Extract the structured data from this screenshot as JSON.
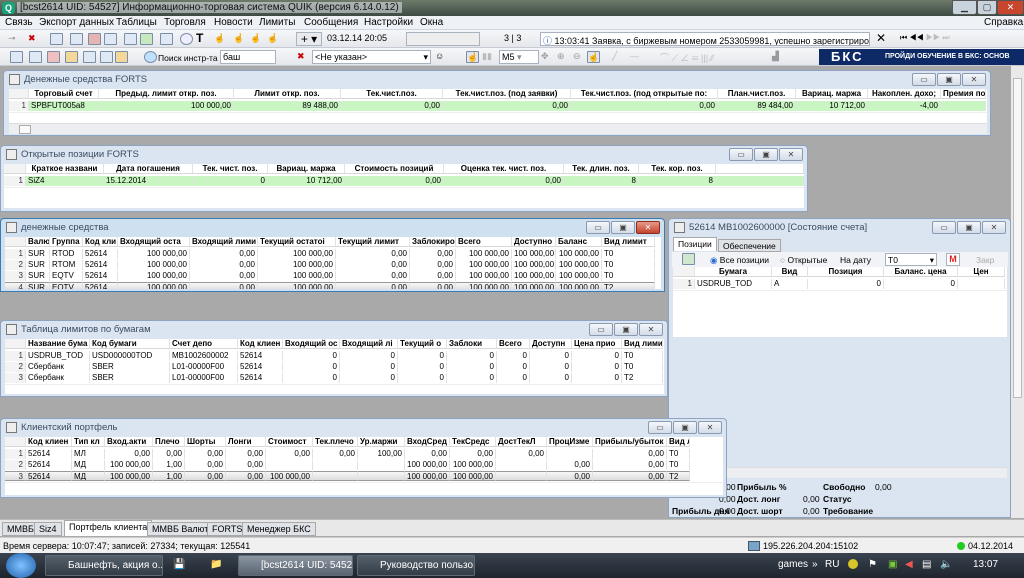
{
  "app": {
    "title": "[bcst2614 UID: 54527] Информационно-торговая система QUIK (версия 6.14.0.12)",
    "logo": "Q"
  },
  "menu": [
    "Связь",
    "Экспорт данных",
    "Таблицы",
    "Торговля",
    "Новости",
    "Лимиты",
    "Сообщения",
    "Настройки",
    "Окна"
  ],
  "menu_help": "Справка",
  "toolbar": {
    "datetime": "03.12.14 20:05",
    "counter": "3 | 3",
    "message": "13:03:41  Заявка, с биржевым номером 2533059981, успешно зарегистрирова",
    "search_label": "Поиск инстр-та",
    "search_value": "баш",
    "client_select": "<Не указан>",
    "interval": "M5",
    "banner_logo": "БКС",
    "banner_text": "ПРОЙДИ ОБУЧЕНИЕ В БКС: ОСНОВ"
  },
  "windows": {
    "forts_money": {
      "title": "Денежные средства FORTS",
      "headers": [
        "",
        "Торговый счет",
        "Предыд. лимит откр. поз.",
        "Лимит откр. поз.",
        "Тек.чист.поз.",
        "Тек.чист.поз. (под заявки)",
        "Тек.чист.поз. (под открытые по:",
        "План.чист.поз.",
        "Вариац. маржа",
        "Накоплен. дохо;",
        "Премия по"
      ],
      "rows": [
        [
          "1",
          "SPBFUT005a8",
          "100 000,00",
          "89 488,00",
          "0,00",
          "0,00",
          "0,00",
          "89 484,00",
          "10 712,00",
          "-4,00",
          ""
        ]
      ]
    },
    "forts_positions": {
      "title": "Открытые позиции FORTS",
      "headers": [
        "",
        "Краткое названи",
        "Дата погашения",
        "Тек. чист. поз.",
        "Вариац. маржа",
        "Стоимость позиций",
        "Оценка тек. чист. поз.",
        "Тек. длин. поз.",
        "Тек. кор. поз.",
        ""
      ],
      "rows": [
        [
          "1",
          "SiZ4",
          "15.12.2014",
          "0",
          "10 712,00",
          "0,00",
          "0,00",
          "8",
          "8",
          ""
        ]
      ]
    },
    "money": {
      "title": "денежные средства",
      "headers": [
        "",
        "Валю",
        "Группа",
        "Код кли",
        "Входящий оста",
        "Входящий лими",
        "Текущий остатоі",
        "Текущий лимит",
        "Заблокиро",
        "Всего",
        "Доступно",
        "Баланс",
        "Вид лимит"
      ],
      "rows": [
        [
          "1",
          "SUR",
          "RTOD",
          "52614",
          "100 000,00",
          "0,00",
          "100 000,00",
          "0,00",
          "0,00",
          "100 000,00",
          "100 000,00",
          "100 000,00",
          "T0"
        ],
        [
          "2",
          "SUR",
          "RTOM",
          "52614",
          "100 000,00",
          "0,00",
          "100 000,00",
          "0,00",
          "0,00",
          "100 000,00",
          "100 000,00",
          "100 000,00",
          "T0"
        ],
        [
          "3",
          "SUR",
          "EQTV",
          "52614",
          "100 000,00",
          "0,00",
          "100 000,00",
          "0,00",
          "0,00",
          "100 000,00",
          "100 000,00",
          "100 000,00",
          "T0"
        ],
        [
          "4",
          "SUR",
          "EQTV",
          "52614",
          "100 000,00",
          "0,00",
          "100 000,00",
          "0,00",
          "0,00",
          "100 000,00",
          "100 000,00",
          "100 000,00",
          "T2"
        ]
      ]
    },
    "account_state": {
      "title": "52614 MB1002600000 [Состояние счета]",
      "tabs": [
        "Позиции",
        "Обеспечение"
      ],
      "radio_all": "Все позиции",
      "radio_open": "Открытые",
      "date_label": "На дату",
      "date_value": "T0",
      "m_button": "M",
      "close_button": "Закр",
      "headers": [
        "",
        "Бумага",
        "Вид",
        "Позиция",
        "Баланс. цена",
        "Цен"
      ],
      "rows": [
        [
          "1",
          "USDRUB_TOD",
          "A",
          "0",
          "0",
          ""
        ]
      ],
      "summary": [
        [
          "ть",
          "0,00",
          "Прибыль %",
          "",
          "Свободно",
          "0,00"
        ],
        [
          "",
          "0,00",
          "Дост. лонг",
          "0,00",
          "Статус",
          ""
        ],
        [
          "Прибыль дня",
          "0,00",
          "Дост. шорт",
          "0,00",
          "Требование",
          ""
        ]
      ]
    },
    "sec_limits": {
      "title": "Таблица лимитов по бумагам",
      "headers": [
        "",
        "Название бума",
        "Код бумаги",
        "Счет депо",
        "Код клиен",
        "Входящий ос",
        "Входящий лі",
        "Текущий о",
        "Заблоки",
        "Всего",
        "Доступн",
        "Цена прио",
        "Вид лими"
      ],
      "rows": [
        [
          "1",
          "USDRUB_TOD",
          "USD000000TOD",
          "MB1002600002",
          "52614",
          "0",
          "0",
          "0",
          "0",
          "0",
          "0",
          "0",
          "T0"
        ],
        [
          "2",
          "Сбербанк",
          "SBER",
          "L01-00000F00",
          "52614",
          "0",
          "0",
          "0",
          "0",
          "0",
          "0",
          "0",
          "T0"
        ],
        [
          "3",
          "Сбербанк",
          "SBER",
          "L01-00000F00",
          "52614",
          "0",
          "0",
          "0",
          "0",
          "0",
          "0",
          "0",
          "T2"
        ]
      ]
    },
    "portfolio": {
      "title": "Клиентский портфель",
      "headers": [
        "",
        "Код клиен",
        "Тип кл",
        "Вход.акти",
        "Плечо",
        "Шорты",
        "Лонги",
        "Стоимост",
        "Тек.плечо",
        "Ур.маржи",
        "ВходСред",
        "ТекСредс",
        "ДостТекЛ",
        "ПроцИзме",
        "Прибыль/убыток",
        "Вид л"
      ],
      "rows": [
        [
          "1",
          "52614",
          "МЛ",
          "0,00",
          "0,00",
          "0,00",
          "0,00",
          "0,00",
          "0,00",
          "100,00",
          "0,00",
          "0,00",
          "0,00",
          "",
          "0,00",
          "T0"
        ],
        [
          "2",
          "52614",
          "МД",
          "100 000,00",
          "1,00",
          "0,00",
          "0,00",
          "",
          "",
          "",
          "100 000,00",
          "100 000,00",
          "",
          "0,00",
          "0,00",
          "T0"
        ],
        [
          "3",
          "52614",
          "МД",
          "100 000,00",
          "1,00",
          "0,00",
          "0,00",
          "100 000,00",
          "",
          "",
          "100 000,00",
          "100 000,00",
          "",
          "0,00",
          "0,00",
          "T2"
        ]
      ]
    }
  },
  "bottom_tabs": [
    "ММВБ",
    "Siz4",
    "Портфель клиента",
    "ММВБ Валюта",
    "FORTS",
    "Менеджер БКС"
  ],
  "active_tab": 2,
  "status": {
    "left": "Время сервера: 10:07:47; записей: 27334; текущая: 125541",
    "server": "195.226.204.204:15102",
    "date": "04.12.2014",
    "connection_color": "#22cc22"
  },
  "taskbar": {
    "items": [
      "Башнефть, акция о...",
      "",
      "",
      "[bcst2614 UID: 54527...",
      "Руководство пользо..."
    ],
    "tray_label": "games",
    "lang": "RU",
    "time": "13:07"
  }
}
